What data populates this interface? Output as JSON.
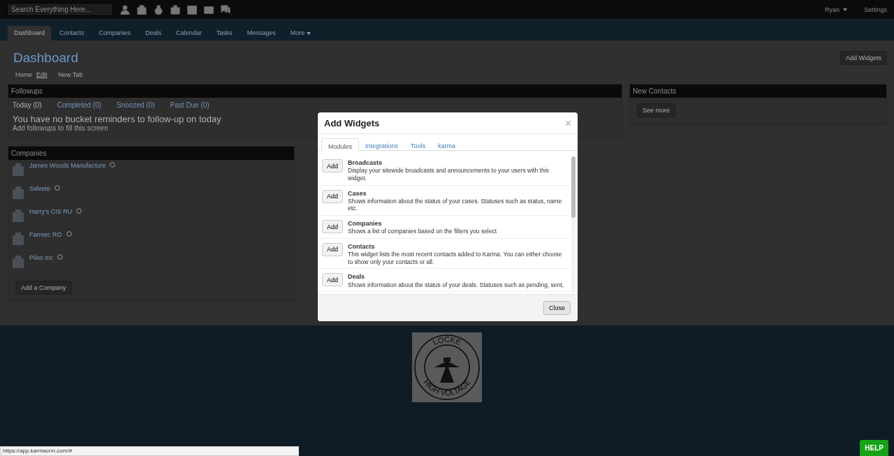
{
  "top_bar": {
    "search": {
      "placeholder": "Search Everything Here..."
    },
    "user_menu": "Ryan",
    "settings": "Settings"
  },
  "nav_tabs": [
    {
      "label": "Dashboard",
      "selected": true,
      "dropdown": false
    },
    {
      "label": "Contacts",
      "selected": false,
      "dropdown": false
    },
    {
      "label": "Companies",
      "selected": false,
      "dropdown": false
    },
    {
      "label": "Deals",
      "selected": false,
      "dropdown": false
    },
    {
      "label": "Calendar",
      "selected": false,
      "dropdown": false
    },
    {
      "label": "Tasks",
      "selected": false,
      "dropdown": false
    },
    {
      "label": "Messages",
      "selected": false,
      "dropdown": false
    },
    {
      "label": "More",
      "selected": false,
      "dropdown": true
    }
  ],
  "page": {
    "title": "Dashboard",
    "add_widgets_button": "Add Widgets"
  },
  "breadcrumbs": [
    {
      "label": "Home",
      "link": false
    },
    {
      "label": "Edit",
      "link": true
    },
    {
      "label": "New Tab",
      "link": false
    }
  ],
  "followups": {
    "title": "Followups",
    "tabs": [
      {
        "label": "Today (0)",
        "selected": true
      },
      {
        "label": "Completed (0)",
        "selected": false
      },
      {
        "label": "Snoozed (0)",
        "selected": false
      },
      {
        "label": "Past Due (0)",
        "selected": false
      }
    ],
    "message": "You have no bucket reminders to follow-up on today",
    "hint": "Add followups to fill this screen"
  },
  "new_contacts": {
    "title": "New Contacts",
    "see_more": "See more"
  },
  "companies": {
    "title": "Companies",
    "items": [
      {
        "name": "James Woods Manufacture"
      },
      {
        "name": "Salvete"
      },
      {
        "name": "Harry's CIS RU"
      },
      {
        "name": "Farmec RO"
      },
      {
        "name": "Pilas Inc"
      }
    ],
    "add_button": "Add a Company"
  },
  "footer_logo": {
    "top_text": "LOCKE",
    "bottom_text": "HIGH VOLTAGE"
  },
  "modal": {
    "title": "Add Widgets",
    "tabs": [
      {
        "label": "Modules",
        "selected": true
      },
      {
        "label": "Integrations",
        "selected": false
      },
      {
        "label": "Tools",
        "selected": false
      },
      {
        "label": "karma",
        "selected": false
      }
    ],
    "widgets": [
      {
        "name": "Broadcasts",
        "description": "Display your sitewide broadcasts and announcements to your users with this widget.",
        "button": "Add"
      },
      {
        "name": "Cases",
        "description": "Shows information about the status of your cases. Statuses such as status, name etc.",
        "button": "Add"
      },
      {
        "name": "Companies",
        "description": "Shows a list of companies based on the filters you select",
        "button": "Add"
      },
      {
        "name": "Contacts",
        "description": "This widget lists the most recent contacts added to Karma. You can either choose to show only your contacts or all.",
        "button": "Add"
      },
      {
        "name": "Deals",
        "description": "Shows information about the status of your deals. Statuses such as pending, sent,",
        "button": "Add"
      }
    ],
    "close_button": "Close"
  },
  "status_url": "https://app.karmacrm.com/#",
  "help_button": "HELP"
}
